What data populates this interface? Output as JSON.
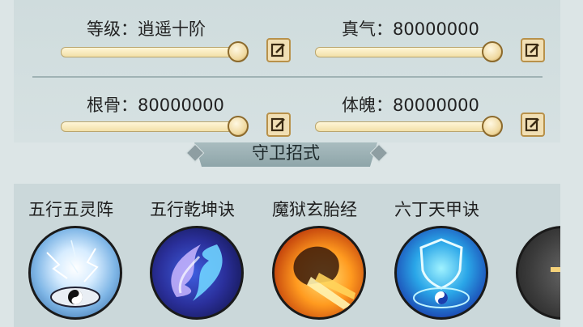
{
  "stats": {
    "level": {
      "label": "等级：逍遥十阶",
      "fill": 1.0
    },
    "qi": {
      "label": "真气：80000000",
      "fill": 1.0
    },
    "root": {
      "label": "根骨：80000000",
      "fill": 1.0
    },
    "soul": {
      "label": "体魄：80000000",
      "fill": 1.0
    }
  },
  "section": {
    "title": "守卫招式"
  },
  "skills": [
    {
      "name": "五行五灵阵",
      "icon": "lightning-taiji-icon"
    },
    {
      "name": "五行乾坤诀",
      "icon": "yin-yang-flame-icon"
    },
    {
      "name": "魔狱玄胎经",
      "icon": "fire-fist-icon"
    },
    {
      "name": "六丁天甲诀",
      "icon": "blue-shield-taiji-icon"
    },
    {
      "name": "",
      "icon": "partial-skill-icon"
    }
  ],
  "colors": {
    "background": "#dce5e6",
    "panel": "#cfdcdd",
    "slider": "#f2e0a8",
    "banner": "#8ea5a9"
  }
}
